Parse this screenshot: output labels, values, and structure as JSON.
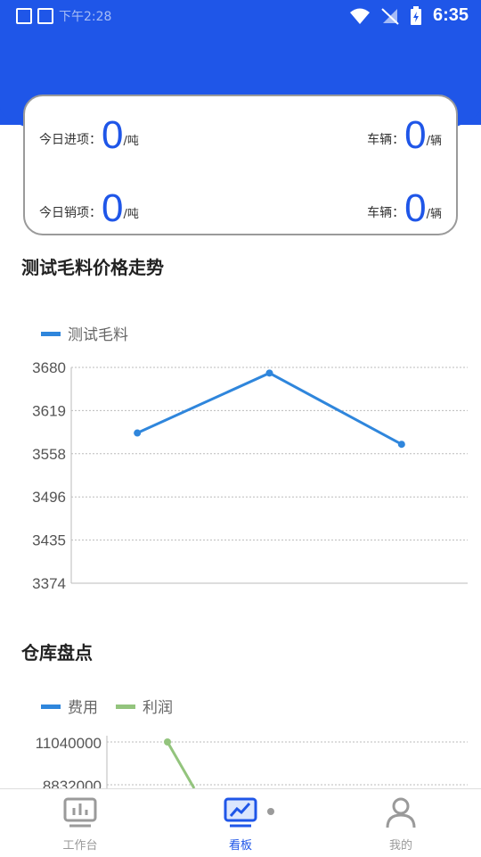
{
  "status_bar": {
    "left_text": "下午2:28",
    "time": "6:35"
  },
  "summary": {
    "incoming_label": "今日进项：",
    "incoming_value": "0",
    "incoming_unit": "/吨",
    "incoming_vehicle_label": "车辆：",
    "incoming_vehicle_value": "0",
    "incoming_vehicle_unit": "/辆",
    "outgoing_label": "今日销项：",
    "outgoing_value": "0",
    "outgoing_unit": "/吨",
    "outgoing_vehicle_label": "车辆：",
    "outgoing_vehicle_value": "0",
    "outgoing_vehicle_unit": "/辆"
  },
  "price_section": {
    "title": "测试毛料价格走势"
  },
  "inventory_section": {
    "title": "仓库盘点"
  },
  "chart_data": [
    {
      "type": "line",
      "title": "测试毛料价格走势",
      "legend": [
        "测试毛料"
      ],
      "legend_position": "top-left",
      "yticks": [
        "3374",
        "3435",
        "3496",
        "3558",
        "3619",
        "3680"
      ],
      "ylim": [
        3374,
        3680
      ],
      "grid": true,
      "x": [
        1,
        2,
        3
      ],
      "series": [
        {
          "name": "测试毛料",
          "color": "#2f86dc",
          "values": [
            3587,
            3672,
            3571
          ]
        }
      ]
    },
    {
      "type": "line",
      "title": "仓库盘点",
      "legend": [
        "费用",
        "利润"
      ],
      "legend_position": "top-left",
      "yticks": [
        "11040000",
        "8832000"
      ],
      "grid": true,
      "series": [
        {
          "name": "费用",
          "color": "#2f86dc",
          "values": []
        },
        {
          "name": "利润",
          "color": "#93c47d",
          "values": [
            11040000
          ]
        }
      ]
    }
  ],
  "tabs": [
    {
      "label": "工作台"
    },
    {
      "label": "看板"
    },
    {
      "label": "我的"
    }
  ],
  "colors": {
    "primary": "#1f56e8",
    "series_blue": "#2f86dc",
    "series_green": "#93c47d",
    "tab_inactive": "#9a9a9a"
  }
}
